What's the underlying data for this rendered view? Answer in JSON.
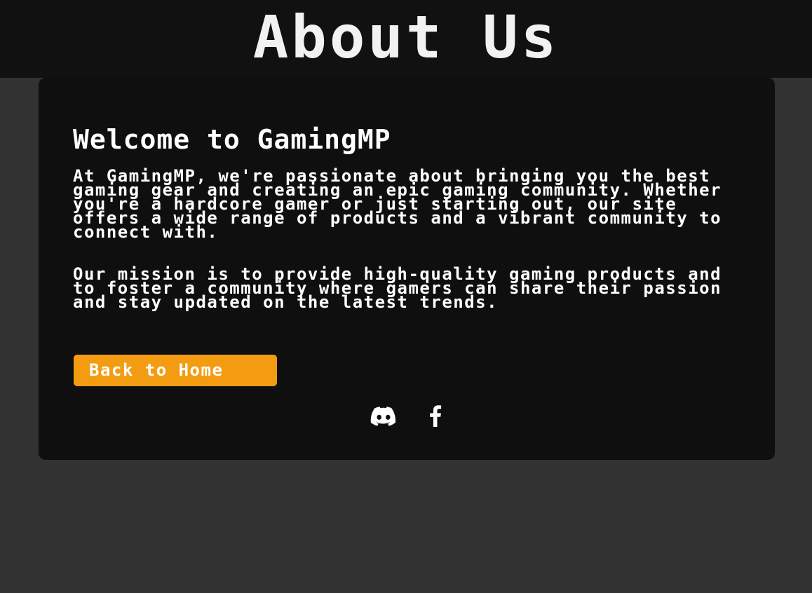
{
  "header": {
    "title": "About Us"
  },
  "main": {
    "heading": "Welcome to GamingMP",
    "paragraphs": [
      "At GamingMP, we're passionate about bringing you the best gaming gear and creating an epic gaming community. Whether you're a hardcore gamer or just starting out, our site offers a wide range of products and a vibrant community to connect with.",
      "Our mission is to provide high-quality gaming products and to foster a community where gamers can share their passion and stay updated on the latest trends."
    ],
    "back_button_label": "Back to Home"
  },
  "social": {
    "icons": [
      "discord-icon",
      "facebook-icon"
    ]
  },
  "colors": {
    "header_bg": "#111111",
    "page_bg": "#323232",
    "card_bg": "#0f0f0f",
    "accent": "#f39c12",
    "text": "#ffffff"
  }
}
